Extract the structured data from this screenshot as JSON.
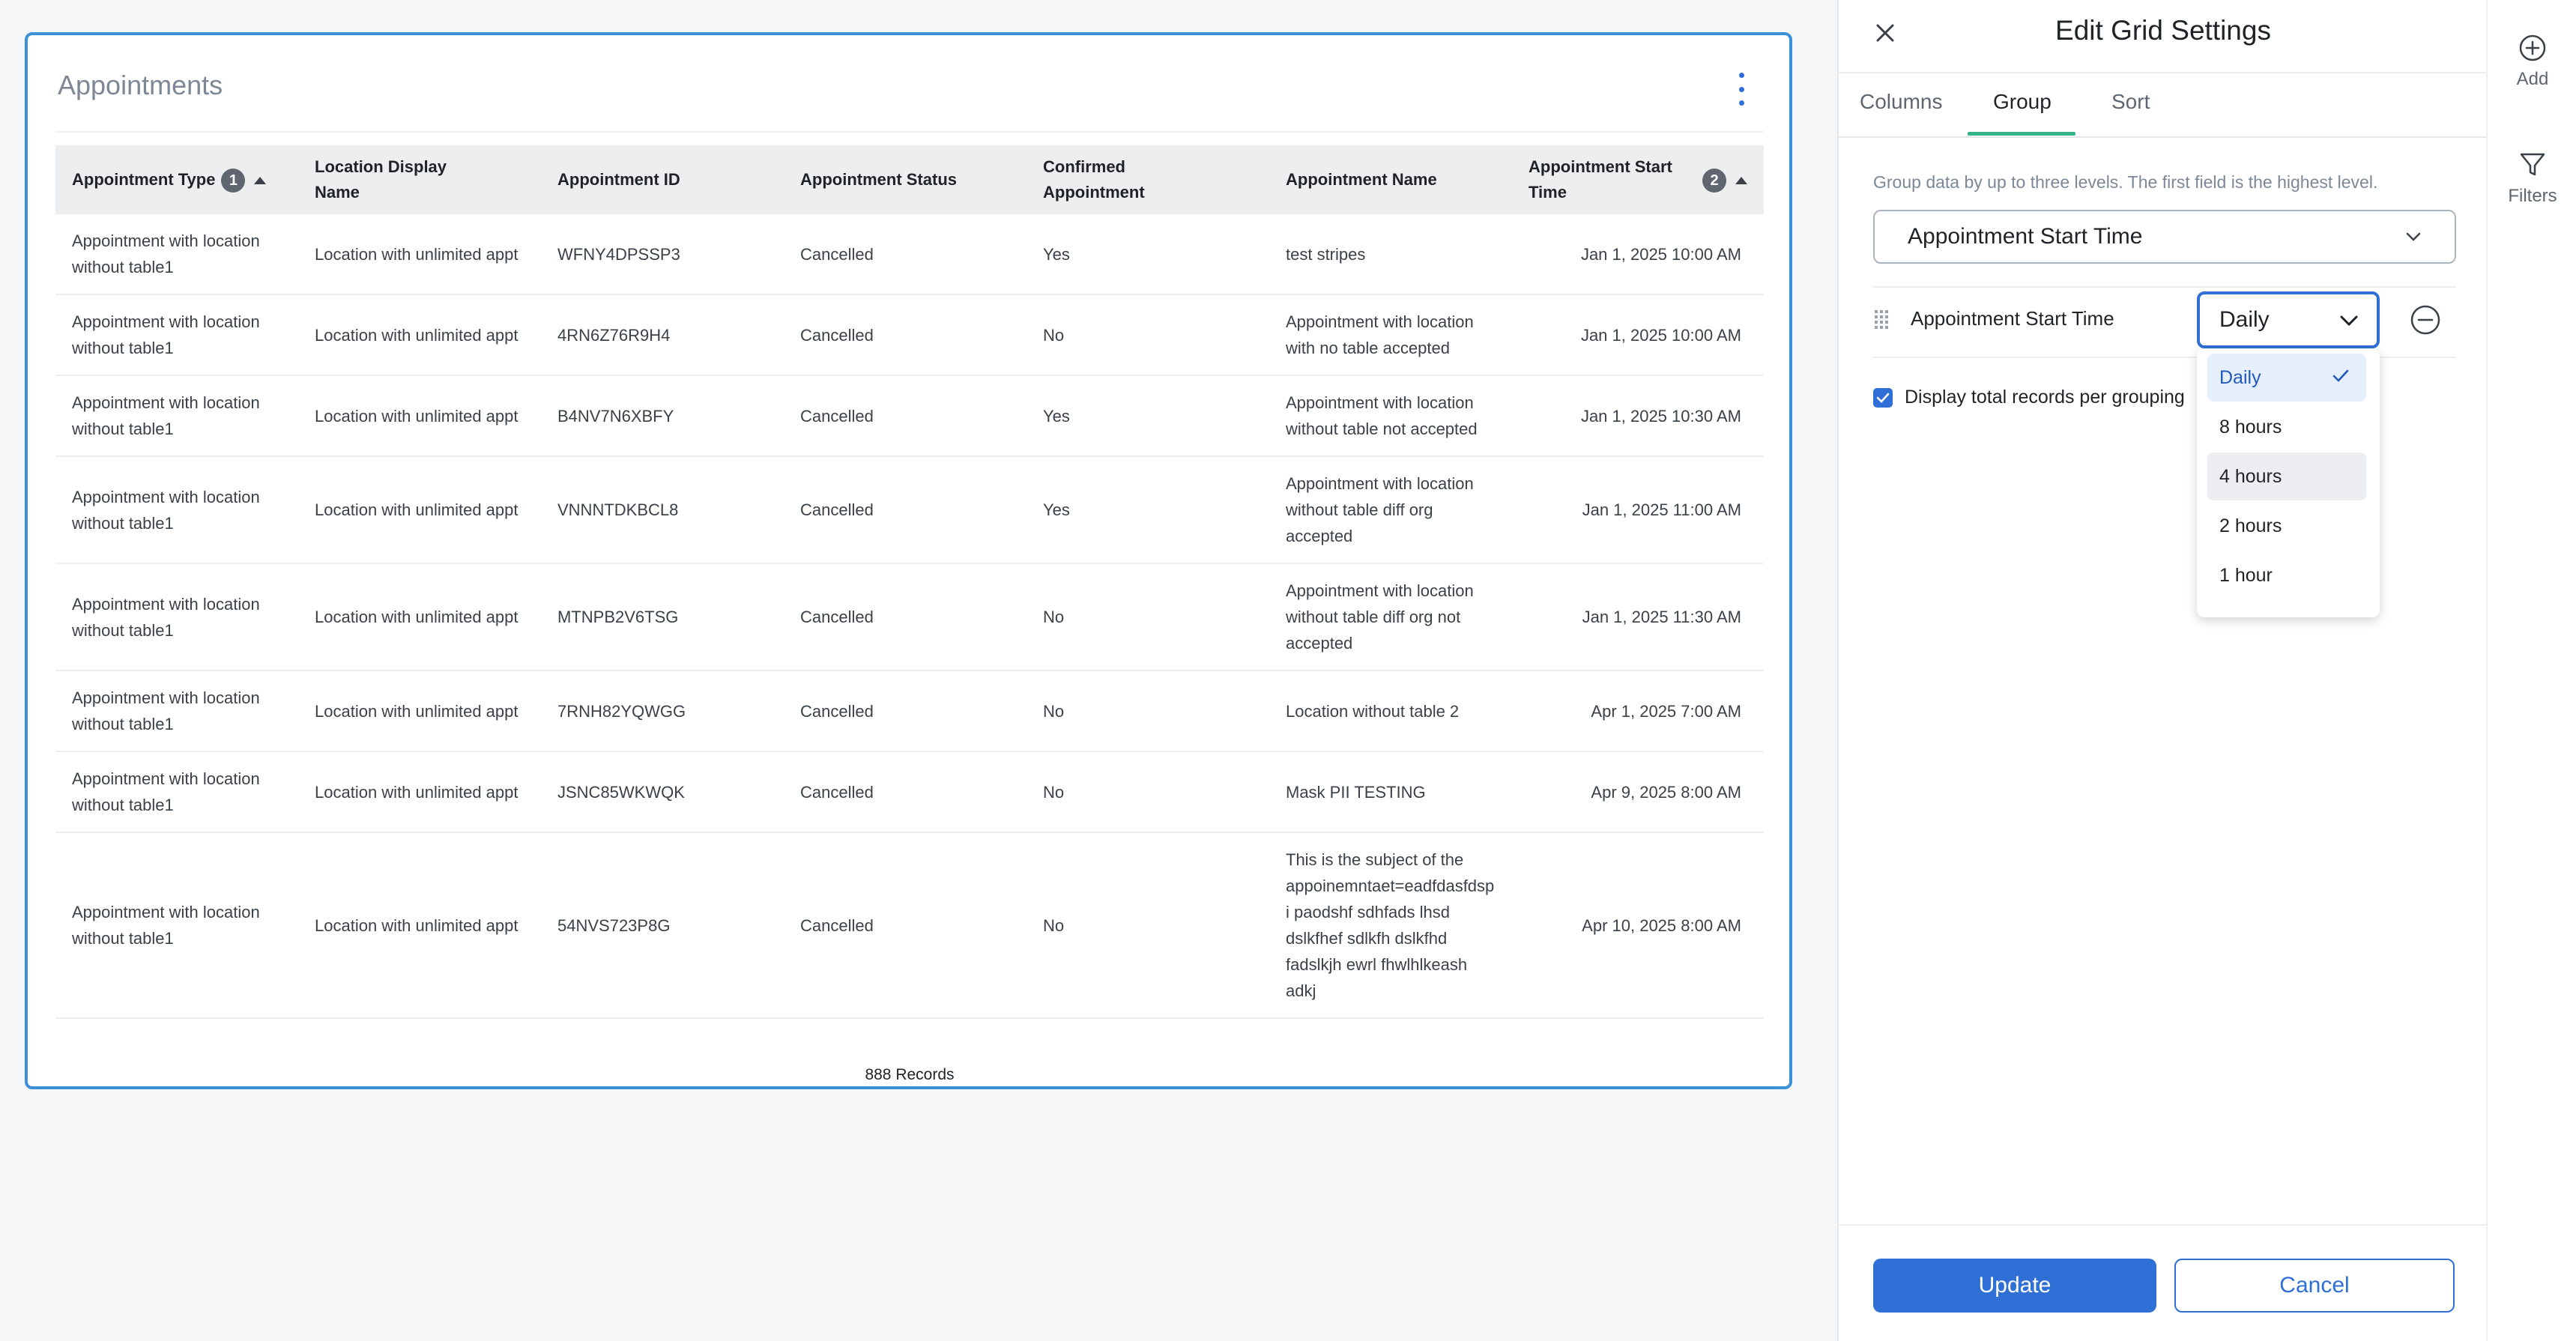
{
  "card": {
    "title": "Appointments",
    "records": "888 Records"
  },
  "grid": {
    "columns": [
      {
        "label": "Appointment Type",
        "badge": "1",
        "sorted": true
      },
      {
        "label": "Location Display Name"
      },
      {
        "label": "Appointment ID"
      },
      {
        "label": "Appointment Status"
      },
      {
        "label": "Confirmed Appointment"
      },
      {
        "label": "Appointment Name"
      },
      {
        "label": "Appointment Start Time",
        "badge": "2",
        "sorted": true
      }
    ],
    "rows": [
      {
        "type": "Appointment with location without table1",
        "location": "Location with unlimited appt",
        "id": "WFNY4DPSSP3",
        "status": "Cancelled",
        "confirmed": "Yes",
        "name": "test stripes",
        "start": "Jan 1, 2025 10:00 AM"
      },
      {
        "type": "Appointment with location without table1",
        "location": "Location with unlimited appt",
        "id": "4RN6Z76R9H4",
        "status": "Cancelled",
        "confirmed": "No",
        "name": "Appointment with location with no table accepted",
        "start": "Jan 1, 2025 10:00 AM"
      },
      {
        "type": "Appointment with location without table1",
        "location": "Location with unlimited appt",
        "id": "B4NV7N6XBFY",
        "status": "Cancelled",
        "confirmed": "Yes",
        "name": "Appointment with location without table not accepted",
        "start": "Jan 1, 2025 10:30 AM"
      },
      {
        "type": "Appointment with location without table1",
        "location": "Location with unlimited appt",
        "id": "VNNNTDKBCL8",
        "status": "Cancelled",
        "confirmed": "Yes",
        "name": "Appointment with location without table diff org accepted",
        "start": "Jan 1, 2025 11:00 AM"
      },
      {
        "type": "Appointment with location without table1",
        "location": "Location with unlimited appt",
        "id": "MTNPB2V6TSG",
        "status": "Cancelled",
        "confirmed": "No",
        "name": "Appointment with location without table diff org not accepted",
        "start": "Jan 1, 2025 11:30 AM"
      },
      {
        "type": "Appointment with location without table1",
        "location": "Location with unlimited appt",
        "id": "7RNH82YQWGG",
        "status": "Cancelled",
        "confirmed": "No",
        "name": "Location without table 2",
        "start": "Apr 1, 2025 7:00 AM"
      },
      {
        "type": "Appointment with location without table1",
        "location": "Location with unlimited appt",
        "id": "JSNC85WKWQK",
        "status": "Cancelled",
        "confirmed": "No",
        "name": "Mask PII TESTING",
        "start": "Apr 9, 2025 8:00 AM"
      },
      {
        "type": "Appointment with location without table1",
        "location": "Location with unlimited appt",
        "id": "54NVS723P8G",
        "status": "Cancelled",
        "confirmed": "No",
        "name": "This is the subject of the appoinemntaet=eadfdasfdsp i paodshf sdhfads lhsd dslkfhef sdlkfh dslkfhd fadslkjh ewrl fhwlhlkeash adkj",
        "start": "Apr 10, 2025 8:00 AM"
      }
    ]
  },
  "panel": {
    "title": "Edit Grid Settings",
    "tabs": [
      "Columns",
      "Group",
      "Sort"
    ],
    "active_tab": "Group",
    "hint": "Group data by up to three levels. The first field is the highest level.",
    "group_field": "Appointment Start Time",
    "group_row_label": "Appointment Start Time",
    "interval_value": "Daily",
    "interval_options": [
      "Daily",
      "8 hours",
      "4 hours",
      "2 hours",
      "1 hour"
    ],
    "display_total_label": "Display total records per grouping",
    "display_total_checked": true,
    "update_label": "Update",
    "cancel_label": "Cancel"
  },
  "rail": {
    "add_label": "Add",
    "filters_label": "Filters"
  },
  "colors": {
    "accent": "#2f6fd6",
    "card_border": "#3d8fd8",
    "tab_underline": "#35b48a"
  }
}
